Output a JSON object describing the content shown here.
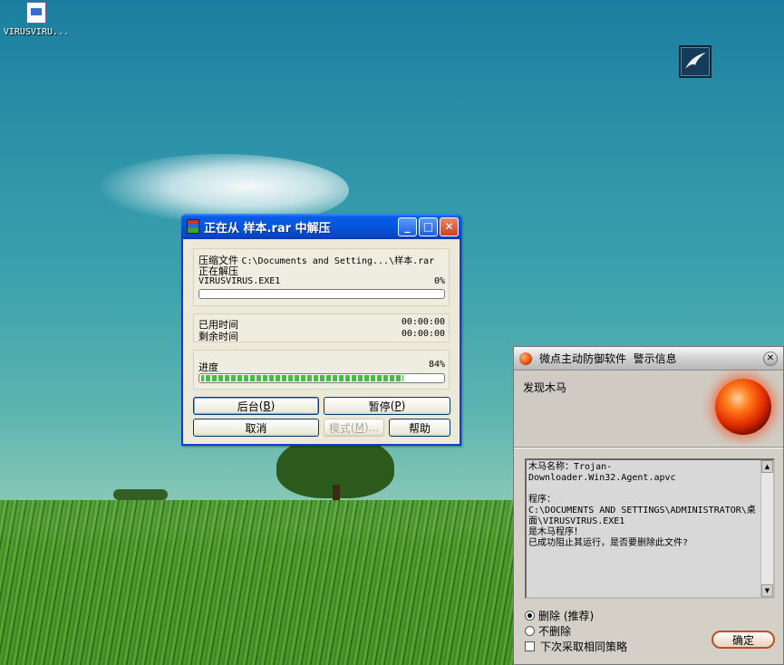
{
  "desktop": {
    "file_icon_label": "VIRUSVIRU..."
  },
  "winrar": {
    "title": "正在从 样本.rar 中解压",
    "archive_label": "压缩文件",
    "archive_path": "C:\\Documents and Setting...\\样本.rar",
    "status": "正在解压",
    "current_file": "VIRUSVIRUS.EXE1",
    "file_percent": "0%",
    "file_progress": 0,
    "elapsed_label": "已用时间",
    "elapsed_value": "00:00:00",
    "remaining_label": "剩余时间",
    "remaining_value": "00:00:00",
    "progress_label": "进度",
    "progress_percent": "84%",
    "progress": 0.84,
    "buttons": {
      "background": "后台",
      "background_key": "B",
      "pause": "暂停",
      "pause_key": "P",
      "cancel": "取消",
      "mode": "模式",
      "mode_key": "M",
      "help": "帮助"
    }
  },
  "alert": {
    "title": "微点主动防御软件  警示信息",
    "found": "发现木马",
    "message": "木马名称：Trojan-\nDownloader.Win32.Agent.apvc\n\n程序：\nC:\\DOCUMENTS AND SETTINGS\\ADMINISTRATOR\\桌面\\VIRUSVIRUS.EXE1\n是木马程序！\n已成功阻止其运行，是否要删除此文件?",
    "options": {
      "delete": "删除 (推荐)",
      "keep": "不删除",
      "remember": "下次采取相同策略"
    },
    "ok": "确定"
  }
}
